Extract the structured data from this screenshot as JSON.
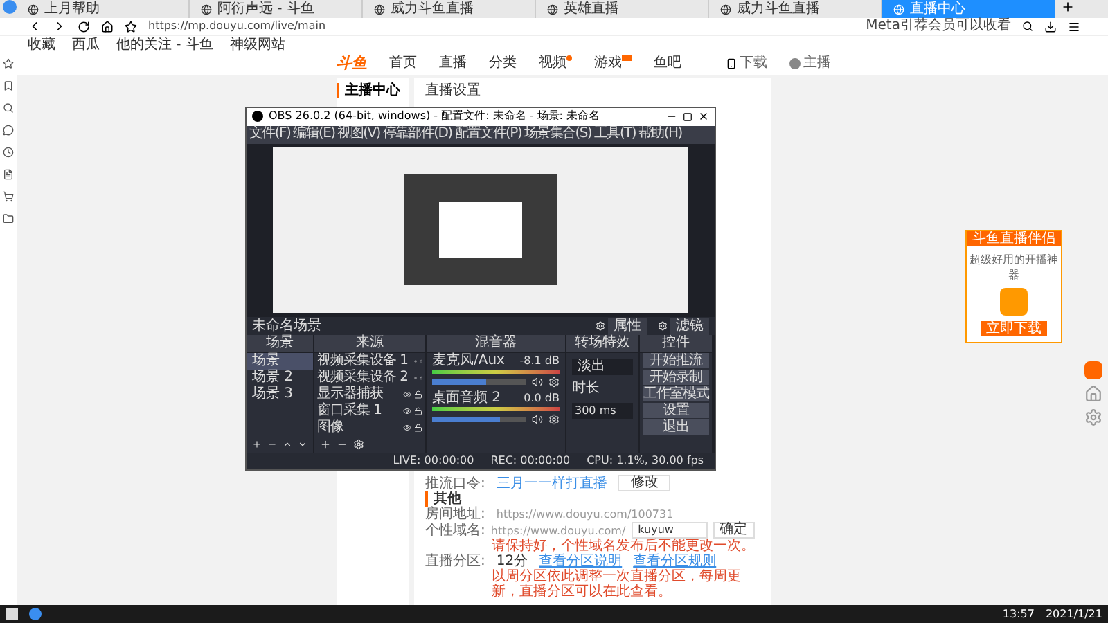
{
  "browser": {
    "tabs": [
      {
        "title": "上月帮助",
        "selected": false
      },
      {
        "title": "阿衍声远 - 斗鱼",
        "selected": false
      },
      {
        "title": "威力斗鱼直播",
        "selected": false
      },
      {
        "title": "英雄直播",
        "selected": false
      },
      {
        "title": "威力斗鱼直播",
        "selected": false
      },
      {
        "title": "直播中心",
        "selected": true
      }
    ],
    "url": "https://mp.douyu.com/live/main",
    "search_text": "Meta引荐会员可以收看",
    "bookmarks": [
      "收藏",
      "西瓜",
      "他的关注 - 斗鱼",
      "神级网站"
    ]
  },
  "site": {
    "logo": "斗鱼",
    "nav": [
      {
        "label": "首页",
        "dot": false,
        "tag": false
      },
      {
        "label": "直播",
        "dot": false,
        "tag": false
      },
      {
        "label": "分类",
        "dot": false,
        "tag": false
      },
      {
        "label": "视频",
        "dot": true,
        "tag": false
      },
      {
        "label": "游戏",
        "dot": false,
        "tag": true
      },
      {
        "label": "鱼吧",
        "dot": false,
        "tag": false
      }
    ],
    "download": "下载",
    "user": "主播"
  },
  "page": {
    "sidebar_title": "主播中心",
    "title": "直播设置",
    "stream_label": "推流口令:",
    "stream_link": "三月一一样打直播",
    "stream_button": "修改",
    "other_title": "其他",
    "room_label": "房间地址:",
    "room_url": "https://www.douyu.com/100731",
    "domain_label": "个性域名:",
    "domain_prefix": "https://www.douyu.com/",
    "domain_value": "kuyuw",
    "domain_button": "确定",
    "domain_error": "请保持好，个性域名发布后不能更改一次。",
    "zone_label": "直播分区:",
    "zone_value": "12分",
    "zone_links": [
      "查看分区说明",
      "查看分区规则"
    ],
    "zone_note": "以周分区依此调整一次直播分区，每周更新，直播分区可以在此查看。"
  },
  "obs": {
    "title": "OBS 26.0.2 (64-bit, windows) - 配置文件: 未命名 - 场景: 未命名",
    "menu": [
      "文件(F)",
      "编辑(E)",
      "视图(V)",
      "停靠部件(D)",
      "配置文件(P)",
      "场景集合(S)",
      "工具(T)",
      "帮助(H)"
    ],
    "scene_name": "未命名场景",
    "scene_buttons": [
      "属性",
      "滤镜"
    ],
    "docks": [
      "场景",
      "来源",
      "混音器",
      "转场特效",
      "控件"
    ],
    "scenes": [
      {
        "name": "场景",
        "selected": true
      },
      {
        "name": "场景 2",
        "selected": false
      },
      {
        "name": "场景 3",
        "selected": false
      }
    ],
    "sources": [
      "视频采集设备 1",
      "视频采集设备 2",
      "显示器捕获",
      "窗口采集 1",
      "图像"
    ],
    "mixer": [
      {
        "name": "麦克风/Aux",
        "reading": "-8.1 dB",
        "level": 0.58
      },
      {
        "name": "桌面音频 2",
        "reading": "0.0 dB",
        "level": 0.72
      }
    ],
    "transition": "淡出",
    "duration_label": "时长",
    "duration": "300 ms",
    "controls": [
      "开始推流",
      "开始录制",
      "工作室模式",
      "设置",
      "退出"
    ],
    "status": [
      "LIVE: 00:00:00",
      "REC: 00:00:00",
      "CPU: 1.1%, 30.00 fps"
    ]
  },
  "ad": {
    "title": "斗鱼直播伴侣",
    "text": "超级好用的开播神器",
    "button": "立即下载"
  },
  "taskbar": {
    "time": "13:57",
    "date": "2021/1/21"
  }
}
